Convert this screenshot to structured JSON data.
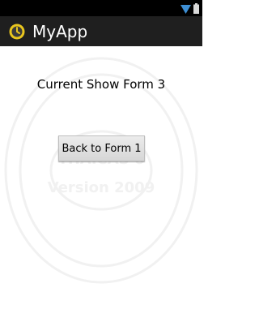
{
  "status_bar": {
    "icons": [
      "wifi-icon",
      "battery-icon"
    ],
    "icon_color": "#3d8ed3"
  },
  "action_bar": {
    "app_icon": "app-icon",
    "title": "MyApp",
    "background": "#1f1f1f"
  },
  "main": {
    "heading": "Current Show Form 3",
    "back_button_label": "Back to Form 1"
  }
}
